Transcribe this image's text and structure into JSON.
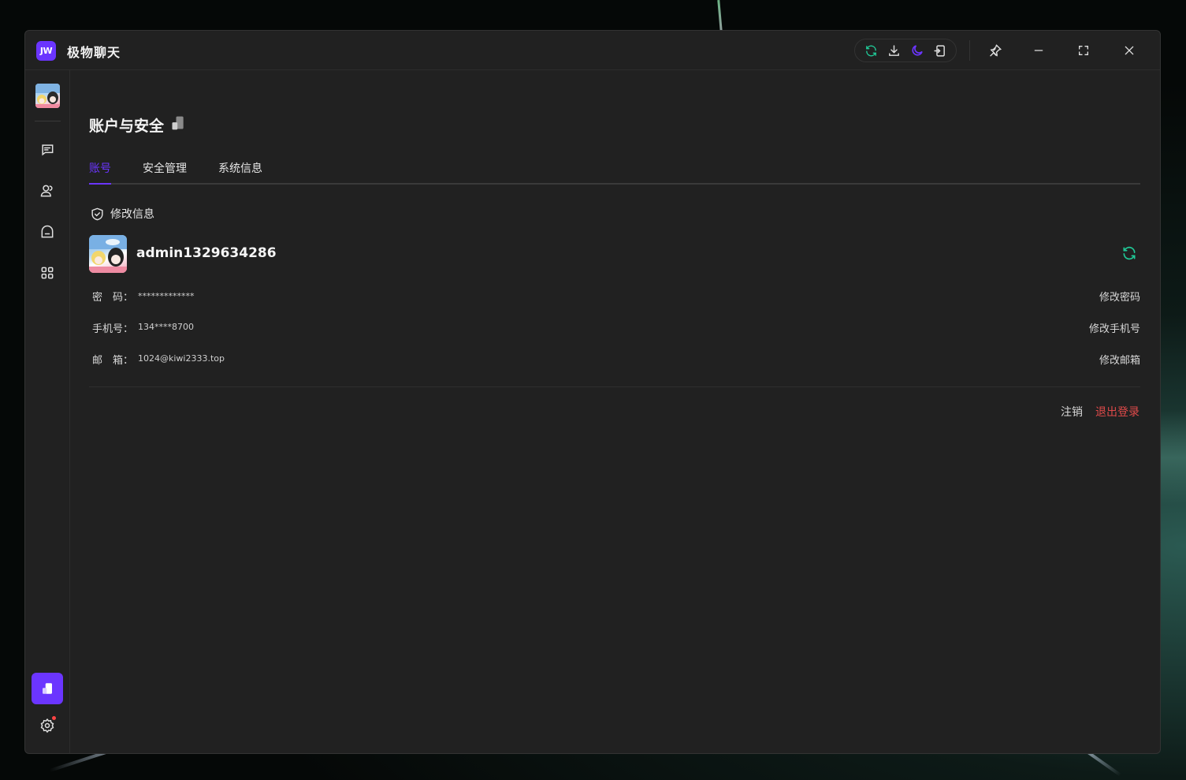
{
  "app": {
    "logo_text": "JW",
    "title": "极物聊天"
  },
  "toolbar": {
    "icons": [
      "refresh-icon",
      "download-icon",
      "moon-icon",
      "exit-screen-icon",
      "pin-icon",
      "minimize-icon",
      "fullscreen-icon",
      "close-icon"
    ],
    "accent_green": "#20c997",
    "accent_purple": "#6b35ff"
  },
  "sidebar": {
    "items": [
      "chat-icon",
      "contacts-icon",
      "ghost-icon",
      "apps-icon"
    ],
    "active_item": "settings-panel-icon",
    "bottom_item": "settings-gear-icon"
  },
  "page": {
    "title": "账户与安全",
    "tabs": [
      {
        "label": "账号",
        "active": true
      },
      {
        "label": "安全管理",
        "active": false
      },
      {
        "label": "系统信息",
        "active": false
      }
    ],
    "section_title": "修改信息",
    "username": "admin1329634286",
    "rows": [
      {
        "label": "密　码：",
        "value": "*************",
        "action": "修改密码"
      },
      {
        "label": "手机号：",
        "value": "134****8700",
        "action": "修改手机号"
      },
      {
        "label": "邮　箱：",
        "value": "1024@kiwi2333.top",
        "action": "修改邮箱"
      }
    ],
    "footer": {
      "deactivate": "注销",
      "logout": "退出登录",
      "logout_color": "#e04a4a"
    }
  }
}
